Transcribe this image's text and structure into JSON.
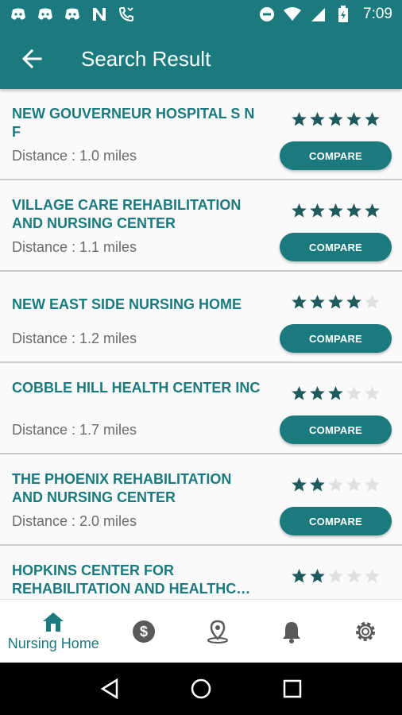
{
  "status_bar": {
    "time": "7:09",
    "left_icons": [
      "discord-icon",
      "discord-icon",
      "discord-icon",
      "n-app-icon",
      "phone-missed-icon"
    ],
    "right_icons": [
      "do-not-disturb-icon",
      "wifi-icon",
      "signal-icon",
      "battery-icon"
    ]
  },
  "header": {
    "title": "Search Result",
    "back_icon": "arrow-back-icon"
  },
  "results": [
    {
      "name": "NEW GOUVERNEUR HOSPITAL S N F",
      "distance": "Distance : 1.0 miles",
      "rating": 5,
      "compare_label": "COMPARE"
    },
    {
      "name": "VILLAGE CARE REHABILITATION AND NURSING CENTER",
      "distance": "Distance : 1.1 miles",
      "rating": 5,
      "compare_label": "COMPARE"
    },
    {
      "name": "NEW EAST SIDE NURSING HOME",
      "distance": "Distance : 1.2 miles",
      "rating": 4,
      "compare_label": "COMPARE"
    },
    {
      "name": "COBBLE HILL HEALTH CENTER INC",
      "distance": "Distance : 1.7 miles",
      "rating": 3,
      "compare_label": "COMPARE"
    },
    {
      "name": "THE PHOENIX REHABILITATION AND NURSING CENTER",
      "distance": "Distance : 2.0 miles",
      "rating": 2,
      "compare_label": "COMPARE"
    },
    {
      "name": "HOPKINS CENTER FOR REHABILITATION AND HEALTHC…",
      "distance": "",
      "rating": 2,
      "compare_label": ""
    }
  ],
  "bottom_nav": {
    "items": [
      {
        "label": "Nursing Home",
        "icon": "home-icon",
        "active": true
      },
      {
        "label": "",
        "icon": "dollar-icon",
        "active": false
      },
      {
        "label": "",
        "icon": "location-pin-icon",
        "active": false
      },
      {
        "label": "",
        "icon": "bell-icon",
        "active": false
      },
      {
        "label": "",
        "icon": "gear-icon",
        "active": false
      }
    ]
  },
  "colors": {
    "primary": "#1a7a7e",
    "star_filled": "#1f5a5c",
    "star_empty": "#e0e0e0",
    "nav_inactive_icon": "#5a5a5a",
    "distance_text": "#6b6b6b"
  }
}
